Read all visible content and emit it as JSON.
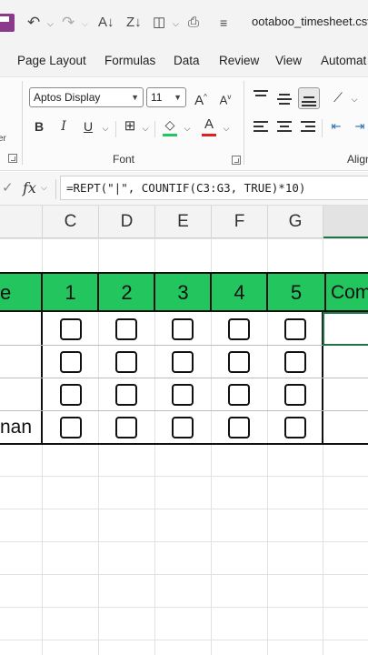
{
  "titlebar": {
    "filename": "ootaboo_timesheet.csv",
    "icons": [
      "save-icon",
      "undo-icon",
      "redo-icon",
      "sort-ascending-icon",
      "sort-descending-icon",
      "shapes-icon",
      "print-preview-icon",
      "customize-qat-icon"
    ]
  },
  "tabs": [
    "Page Layout",
    "Formulas",
    "Data",
    "Review",
    "View",
    "Automat"
  ],
  "ribbon": {
    "left_group_label": "er",
    "font_name": "Aptos Display",
    "font_size": "11",
    "font_group_label": "Font",
    "align_group_label": "Align",
    "bold": "B",
    "italic": "I",
    "underline": "U",
    "grow_font": "A",
    "shrink_font": "A",
    "font_color_letter": "A",
    "fill_color": "#22c55e",
    "font_color": "#e02020"
  },
  "formula_bar": {
    "fx_label": "fx",
    "formula": "=REPT(\"|\", COUNTIF(C3:G3, TRUE)*10)"
  },
  "columns": [
    "C",
    "D",
    "E",
    "F",
    "G",
    ""
  ],
  "table": {
    "header_left": "e",
    "headers": [
      "1",
      "2",
      "3",
      "4",
      "5"
    ],
    "header_comment": "Com",
    "row_labels": [
      "",
      "",
      "",
      "nan"
    ],
    "header_color": "#22c55e"
  }
}
